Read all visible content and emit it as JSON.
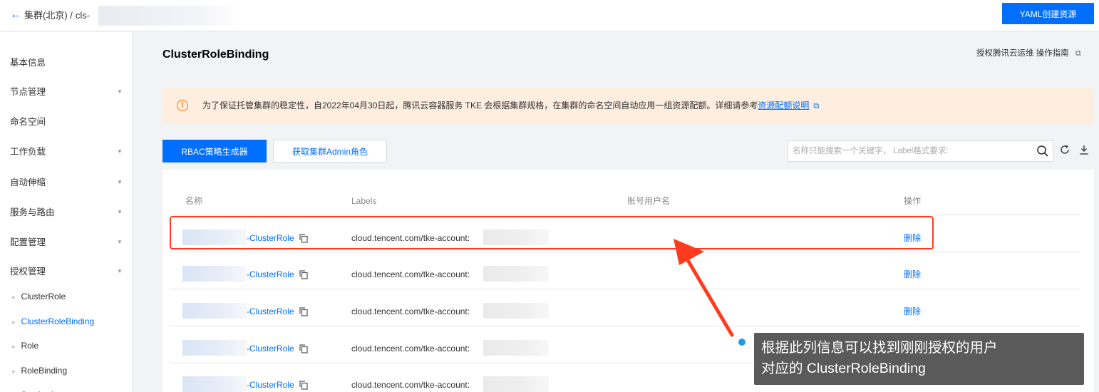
{
  "header": {
    "back_glyph": "←",
    "breadcrumb": "集群(北京) /",
    "cluster_prefix": "cls-",
    "yaml_button": "YAML创建资源"
  },
  "sidebar": {
    "items": [
      {
        "label": "基本信息",
        "has_caret": false
      },
      {
        "label": "节点管理",
        "has_caret": true
      },
      {
        "label": "命名空间",
        "has_caret": false
      },
      {
        "label": "工作负载",
        "has_caret": true
      },
      {
        "label": "自动伸缩",
        "has_caret": true
      },
      {
        "label": "服务与路由",
        "has_caret": true
      },
      {
        "label": "配置管理",
        "has_caret": true
      },
      {
        "label": "授权管理",
        "has_caret": true
      }
    ],
    "sub_items": [
      {
        "label": "ClusterRole",
        "active": false
      },
      {
        "label": "ClusterRoleBinding",
        "active": true
      },
      {
        "label": "Role",
        "active": false
      },
      {
        "label": "RoleBinding",
        "active": false
      },
      {
        "label": "ServiceAccount",
        "active": false
      }
    ],
    "caret_glyph": "▼",
    "dot_glyph": "●"
  },
  "page": {
    "title": "ClusterRoleBinding",
    "top_right": "授权腾讯云运维 操作指南",
    "notice": {
      "icon": "warning-circle-icon",
      "icon_glyph": "!",
      "text": "为了保证托管集群的稳定性，自2022年04月30日起，腾讯云容器服务 TKE 会根据集群规格，在集群的命名空间自动应用一组资源配额。详细请参考",
      "link": "资源配额说明"
    },
    "external_glyph": "⧉"
  },
  "toolbar": {
    "rbac_button": "RBAC策略生成器",
    "admin_button": "获取集群Admin角色",
    "search_placeholder": "名称只能搜索一个关键字， Label格式要求:",
    "search_value": ""
  },
  "table": {
    "headers": [
      "名称",
      "Labels",
      "账号用户名",
      "操作"
    ],
    "rows": [
      {
        "name_suffix": "-ClusterRole",
        "label": "cloud.tencent.com/tke-account:",
        "action": "删除"
      },
      {
        "name_suffix": "-ClusterRole",
        "label": "cloud.tencent.com/tke-account:",
        "action": "删除"
      },
      {
        "name_suffix": "-ClusterRole",
        "label": "cloud.tencent.com/tke-account:",
        "action": "删除"
      },
      {
        "name_suffix": "-ClusterRole",
        "label": "cloud.tencent.com/tke-account:",
        "action": ""
      },
      {
        "name_suffix": "-ClusterRole",
        "label": "cloud.tencent.com/tke-account:",
        "action": ""
      }
    ]
  },
  "annotation": {
    "line1": "根据此列信息可以找到刚刚授权的用户",
    "line2": "对应的 ClusterRoleBinding",
    "color": "#ff3b1f"
  },
  "colors": {
    "primary": "#006eff",
    "notice_bg": "#fdeee0",
    "warning": "#ff7200"
  }
}
